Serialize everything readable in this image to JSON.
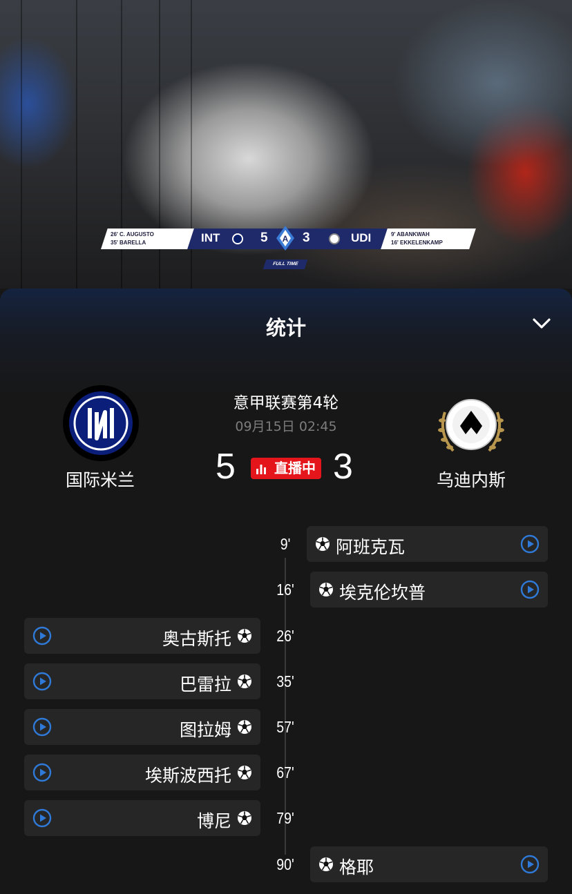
{
  "video": {
    "scorebug": {
      "home_scorers": [
        "26' C. AUGUSTO",
        "35' BARELLA"
      ],
      "home_abbr": "INT",
      "home_score": "5",
      "away_score": "3",
      "away_abbr": "UDI",
      "away_scorers": [
        "9' ABANKWAH",
        "16' EKKELENKAMP"
      ],
      "status": "FULL TIME"
    }
  },
  "panel": {
    "title": "统计",
    "collapse_icon": "chevron-down-icon"
  },
  "match": {
    "league_round": "意甲联赛第4轮",
    "datetime": "09月15日 02:45",
    "home": {
      "name": "国际米兰",
      "score": "5",
      "colors": [
        "#0b1f7a",
        "#000000"
      ]
    },
    "away": {
      "name": "乌迪内斯",
      "score": "3",
      "colors": [
        "#ffffff",
        "#000000"
      ]
    },
    "live_label": "直播中",
    "live_color": "#e4161b"
  },
  "events": [
    {
      "minute": "9'",
      "side": "away",
      "player": "阿班克瓦"
    },
    {
      "minute": "16'",
      "side": "away",
      "player": "埃克伦坎普"
    },
    {
      "minute": "26'",
      "side": "home",
      "player": "奥古斯托"
    },
    {
      "minute": "35'",
      "side": "home",
      "player": "巴雷拉"
    },
    {
      "minute": "57'",
      "side": "home",
      "player": "图拉姆"
    },
    {
      "minute": "67'",
      "side": "home",
      "player": "埃斯波西托"
    },
    {
      "minute": "79'",
      "side": "home",
      "player": "博尼"
    },
    {
      "minute": "90'",
      "side": "away",
      "player": "格耶"
    }
  ],
  "accent_color": "#2f7ad8"
}
